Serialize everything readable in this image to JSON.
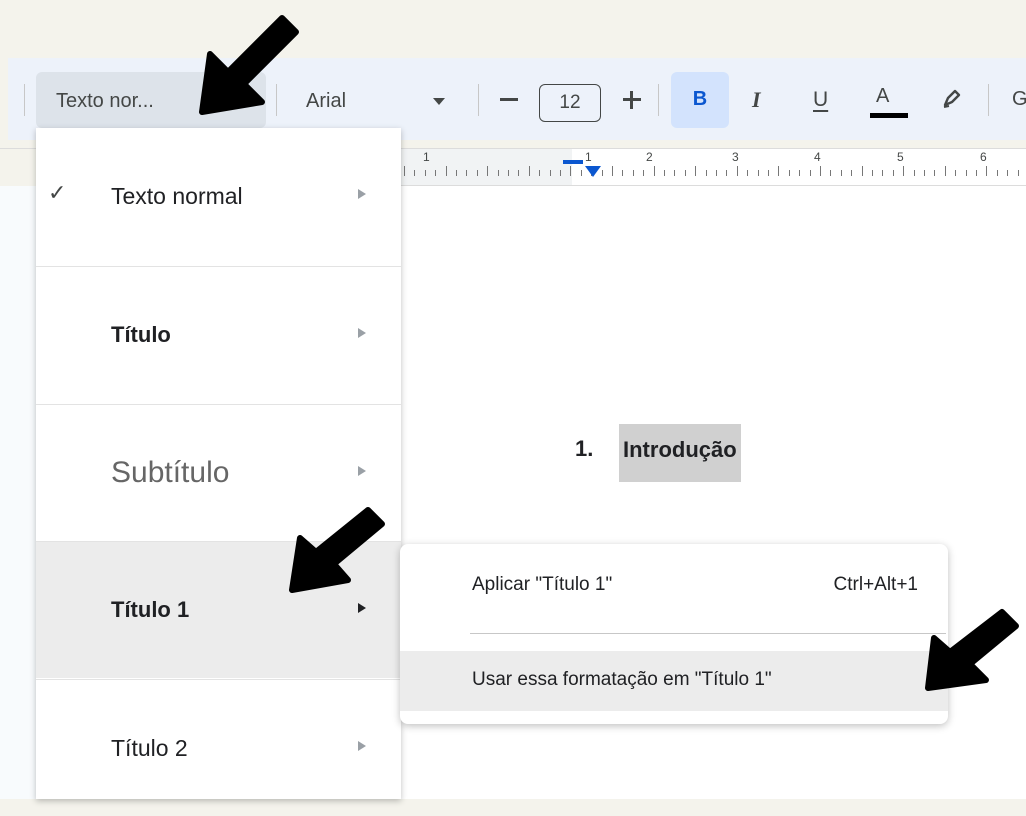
{
  "toolbar": {
    "style_select_label": "Texto nor...",
    "font_name": "Arial",
    "font_size": "12",
    "bold_label": "B",
    "italic_label": "I",
    "underline_label": "U",
    "text_color_label": "A",
    "text_color": "#000000"
  },
  "ruler": {
    "numbers": [
      "1",
      "1",
      "2",
      "3",
      "4",
      "5",
      "6"
    ]
  },
  "style_menu": {
    "items": [
      {
        "label": "Texto normal",
        "checked": true
      },
      {
        "label": "Título"
      },
      {
        "label": "Subtítulo"
      },
      {
        "label": "Título 1",
        "highlighted": true
      },
      {
        "label": "Título 2"
      }
    ]
  },
  "submenu": {
    "apply_label": "Aplicar \"Título 1\"",
    "apply_shortcut": "Ctrl+Alt+1",
    "use_format_label": "Usar essa formatação em \"Título 1\""
  },
  "document": {
    "heading_number": "1.",
    "heading_text": "Introdução"
  },
  "colors": {
    "accent": "#0b57d0",
    "active_button_bg": "#d3e3fd",
    "menu_highlight": "#ececec",
    "page_background": "#f4f3ec"
  }
}
